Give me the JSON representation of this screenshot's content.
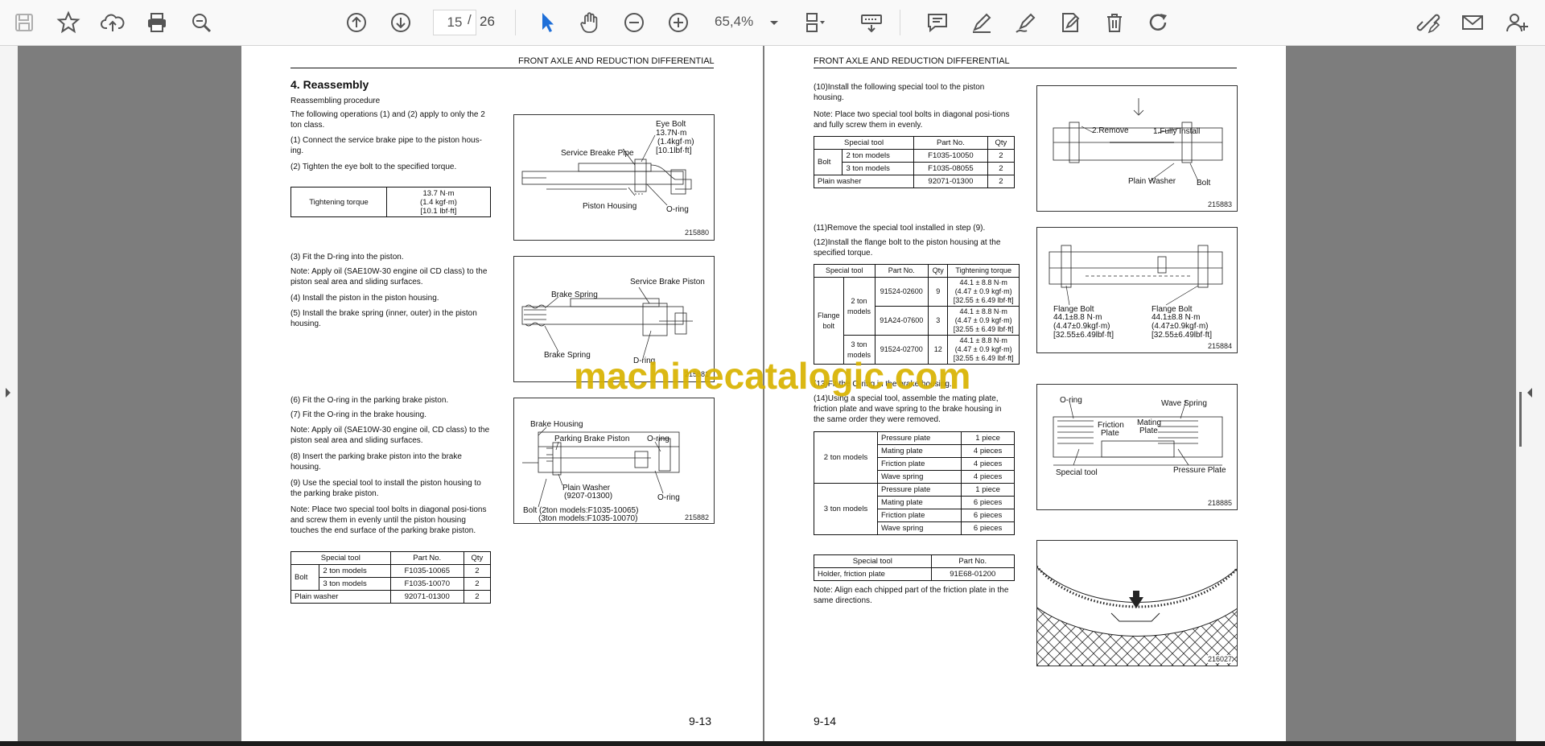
{
  "toolbar": {
    "page_current": "15",
    "page_sep": "/",
    "page_total": "26",
    "zoom": "65,4%"
  },
  "page_left": {
    "header": "FRONT AXLE AND REDUCTION DIFFERENTIAL",
    "section_title": "4.  Reassembly",
    "subtitle": "Reassembling procedure",
    "intro": "The following operations (1) and (2) apply to only the 2 ton class.",
    "s1": "(1)  Connect the service brake pipe to the piston hous-ing.",
    "s2": "(2)  Tighten the eye bolt to the specified torque.",
    "torque_label": "Tightening torque",
    "torque_v1": "13.7 N·m",
    "torque_v2": "(1.4 kgf·m)",
    "torque_v3": "[10.1 lbf·ft]",
    "s3": "(3)  Fit the D-ring into the piston.",
    "note1": "Note:  Apply oil (SAE10W-30 engine oil CD class) to the piston seal area and sliding surfaces.",
    "s4": "(4)  Install the piston in the piston housing.",
    "s5": "(5)  Install the brake spring (inner, outer) in the piston housing.",
    "s6": "(6)  Fit the O-ring in the parking brake piston.",
    "s7": "(7)  Fit the O-ring in the brake housing.",
    "note2": "Note:  Apply oil (SAE10W-30 engine oil, CD class) to the piston seal area and sliding surfaces.",
    "s8": "(8)  Insert the parking brake piston into the brake housing.",
    "s9": "(9)  Use the special tool to install the piston housing to the parking brake piston.",
    "note3": "Note:  Place two special tool bolts in diagonal posi-tions and screw them in evenly until the piston housing touches the end surface of the parking brake piston.",
    "tool_table": {
      "h_tool": "Special tool",
      "h_part": "Part No.",
      "h_qty": "Qty",
      "bolt": "Bolt",
      "r1_model": "2 ton models",
      "r1_part": "F1035-10065",
      "r1_qty": "2",
      "r2_model": "3 ton models",
      "r2_part": "F1035-10070",
      "r2_qty": "2",
      "r3_tool": "Plain washer",
      "r3_part": "92071-01300",
      "r3_qty": "2"
    },
    "fig1": {
      "eye_bolt": "Eye Bolt",
      "eb_v1": "13.7N·m",
      "eb_v2": "(1.4kgf·m)",
      "eb_v3": "[10.1lbf·ft]",
      "pipe": "Service Breake Pipe",
      "housing": "Piston Housing",
      "oring": "O-ring",
      "num": "215880"
    },
    "fig2": {
      "sbp": "Service Brake Piston",
      "bs1": "Brake Spring",
      "bs2": "Brake Spring",
      "dring": "D-ring",
      "num": "215881"
    },
    "fig3": {
      "bh": "Brake Housing",
      "pbp": "Parking Brake Piston",
      "or1": "O-ring",
      "or2": "O-ring",
      "pw1": "Plain Washer",
      "pw2": "(9207-01300)",
      "bolt1": "Bolt (2ton models:F1035-10065)",
      "bolt2": "(3ton models:F1035-10070)",
      "num": "215882"
    },
    "page_number": "9-13"
  },
  "page_right": {
    "header": "FRONT AXLE AND REDUCTION DIFFERENTIAL",
    "s10": "(10)Install the following special tool to the piston housing.",
    "note1": "Note:  Place two special tool bolts in diagonal posi-tions and fully screw them in evenly.",
    "t1": {
      "h_tool": "Special tool",
      "h_part": "Part No.",
      "h_qty": "Qty",
      "bolt": "Bolt",
      "r1_model": "2 ton models",
      "r1_part": "F1035-10050",
      "r1_qty": "2",
      "r2_model": "3 ton models",
      "r2_part": "F1035-08055",
      "r2_qty": "2",
      "r3_tool": "Plain washer",
      "r3_part": "92071-01300",
      "r3_qty": "2"
    },
    "s11": "(11)Remove the special tool installed in step (9).",
    "s12": "(12)Install the flange bolt to the piston housing at the specified torque.",
    "t2": {
      "h_tool": "Special tool",
      "h_part": "Part No.",
      "h_qty": "Qty",
      "h_torque": "Tightening torque",
      "flange": "Flange bolt",
      "m2": "2 ton models",
      "m3": "3 ton models",
      "r1_part": "91524-02600",
      "r1_qty": "9",
      "r2_part": "91A24-07600",
      "r2_qty": "3",
      "r3_part": "91524-02700",
      "r3_qty": "12",
      "tq1": "44.1 ± 8.8 N·m",
      "tq2": "(4.47 ± 0.9 kgf·m)",
      "tq3": "[32.55 ± 6.49 lbf·ft]"
    },
    "s13": "(13)Fit the O-ring in the brake housing.",
    "s14": "(14)Using a special tool, assemble the mating plate, friction plate and wave spring to the brake housing in the same order they were removed.",
    "t3": {
      "g2": "2 ton models",
      "g3": "3 ton models",
      "rows2": [
        [
          "Pressure plate",
          "1 piece"
        ],
        [
          "Mating plate",
          "4 pieces"
        ],
        [
          "Friction plate",
          "4 pieces"
        ],
        [
          "Wave spring",
          "4 pieces"
        ]
      ],
      "rows3": [
        [
          "Pressure plate",
          "1 piece"
        ],
        [
          "Mating plate",
          "6 pieces"
        ],
        [
          "Friction plate",
          "6 pieces"
        ],
        [
          "Wave spring",
          "6 pieces"
        ]
      ]
    },
    "t4": {
      "h_tool": "Special tool",
      "h_part": "Part No.",
      "tool": "Holder, friction plate",
      "part": "91E68-01200"
    },
    "note2": "Note:  Align each chipped part of the friction plate in the same directions.",
    "fig1": {
      "remove": "2.Remove",
      "install": "1.Fully Install",
      "washer": "Plain Washer",
      "bolt": "Bolt",
      "num": "215883"
    },
    "fig2": {
      "fb1": "Flange Bolt",
      "fb1v1": "44.1±8.8 N·m",
      "fb1v2": "(4.47±0.9kgf·m)",
      "fb1v3": "[32.55±6.49lbf·ft]",
      "fb2": "Flange Bolt",
      "fb2v1": "44.1±8.8 N·m",
      "fb2v2": "(4.47±0.9kgf·m)",
      "fb2v3": "[32.55±6.49lbf·ft]",
      "num": "215884"
    },
    "fig3": {
      "oring": "O-ring",
      "wave": "Wave Spring",
      "fric1": "Friction",
      "fric2": "Plate",
      "mat1": "Mating",
      "mat2": "Plate",
      "tool": "Special tool",
      "press": "Pressure Plate",
      "num": "218885"
    },
    "fig4": {
      "num": "216027"
    },
    "page_number": "9-14"
  },
  "watermark": "machinecatalogic.com"
}
